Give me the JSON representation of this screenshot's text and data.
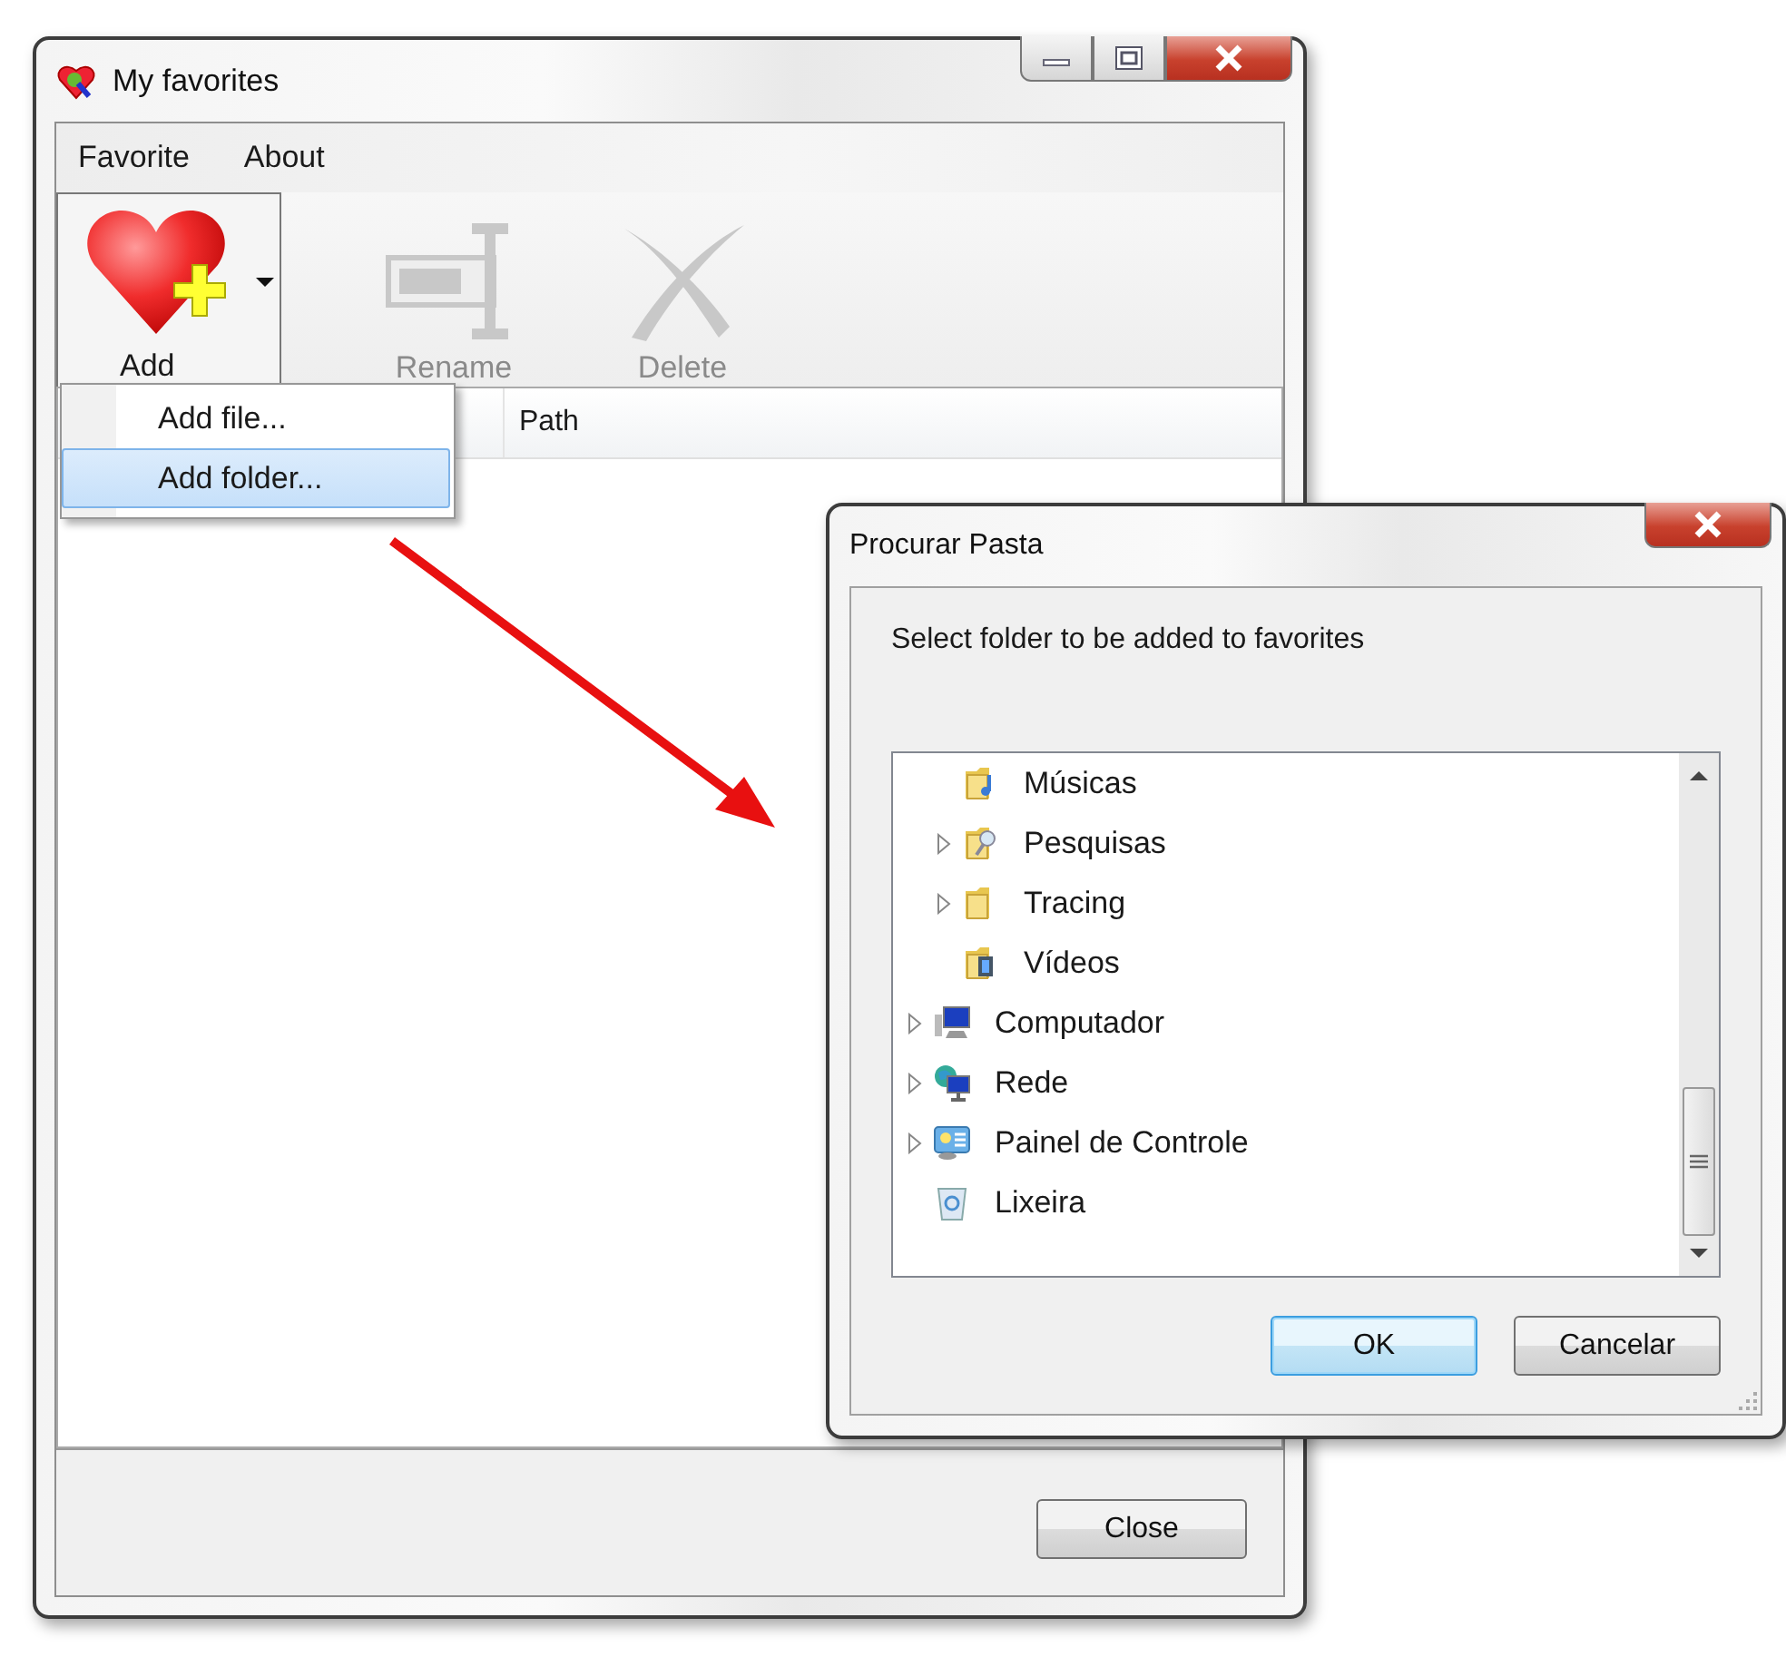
{
  "main_window": {
    "title": "My favorites",
    "menu": [
      {
        "label": "Favorite"
      },
      {
        "label": "About"
      }
    ],
    "toolbar": [
      {
        "label": "Add",
        "kind": "add",
        "disabled": false,
        "open": true
      },
      {
        "label": "Rename",
        "kind": "rename",
        "disabled": true,
        "open": false
      },
      {
        "label": "Delete",
        "kind": "delete",
        "disabled": true,
        "open": false
      }
    ],
    "dropdown_menu": [
      {
        "label": "Add file...",
        "selected": false
      },
      {
        "label": "Add folder...",
        "selected": true
      }
    ],
    "table": {
      "columns": [
        {
          "label": "Path"
        }
      ]
    },
    "buttons": [
      {
        "label": "Close"
      }
    ]
  },
  "dialog": {
    "title": "Procurar Pasta",
    "prompt": "Select folder to be added to favorites",
    "tree": [
      {
        "children": [
          {
            "label": "Músicas",
            "kind": "music-folder",
            "expandable": false
          },
          {
            "label": "Pesquisas",
            "kind": "search-folder",
            "expandable": true
          },
          {
            "label": "Tracing",
            "kind": "folder",
            "expandable": true
          },
          {
            "label": "Vídeos",
            "kind": "video-folder",
            "expandable": false
          }
        ]
      },
      {
        "label": "Computador",
        "kind": "computer",
        "expandable": true
      },
      {
        "label": "Rede",
        "kind": "network",
        "expandable": true
      },
      {
        "label": "Painel de Controle",
        "kind": "control-panel",
        "expandable": true
      },
      {
        "label": "Lixeira",
        "kind": "recycle-bin",
        "expandable": false
      }
    ],
    "buttons": [
      {
        "label": "OK",
        "default": true
      },
      {
        "label": "Cancelar",
        "default": false
      }
    ]
  }
}
